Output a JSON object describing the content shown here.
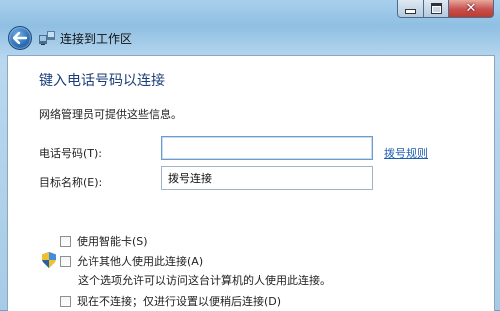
{
  "window": {
    "minimize_icon": "minimize-icon",
    "maximize_icon": "maximize-icon",
    "close_icon": "close-icon",
    "close_glyph": "✕"
  },
  "nav": {
    "back_icon": "back-arrow-icon",
    "network_icon": "network-icon",
    "title": "连接到工作区"
  },
  "main": {
    "heading": "键入电话号码以连接",
    "description": "网络管理员可提供这些信息。",
    "phone": {
      "label": "电话号码(T):",
      "value": ""
    },
    "dialing_rules_link": "拨号规则",
    "destination": {
      "label": "目标名称(E):",
      "value": "拨号连接"
    },
    "options": [
      {
        "label": "使用智能卡(S)",
        "checked": false
      },
      {
        "label": "允许其他人使用此连接(A)",
        "checked": false,
        "icon": "uac-shield-icon",
        "hint": "这个选项允许可以访问这台计算机的人使用此连接。"
      },
      {
        "label": "现在不连接；仅进行设置以便稍后连接(D)",
        "checked": false
      }
    ]
  },
  "colors": {
    "heading": "#1a3e7a",
    "link": "#1f5fb4",
    "close_button": "#c75050"
  }
}
